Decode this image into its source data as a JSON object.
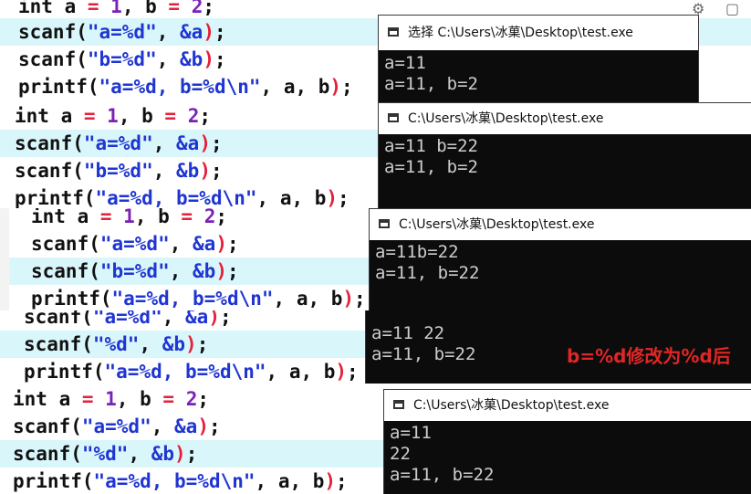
{
  "panel1": {
    "lines": [
      {
        "parts": [
          [
            "kw",
            "int a "
          ],
          [
            "op",
            "= "
          ],
          [
            "num",
            "1"
          ],
          [
            "kw",
            ", b "
          ],
          [
            "op",
            "= "
          ],
          [
            "num",
            "2"
          ],
          [
            "kw",
            ";"
          ]
        ]
      },
      {
        "parts": [
          [
            "fn",
            "scanf("
          ],
          [
            "str",
            "\"a=%d\""
          ],
          [
            "kw",
            ", "
          ],
          [
            "amp",
            "&a"
          ],
          [
            "op",
            ")"
          ],
          [
            "kw",
            ";"
          ]
        ]
      },
      {
        "parts": [
          [
            "fn",
            "scanf("
          ],
          [
            "str",
            "\"b=%d\""
          ],
          [
            "kw",
            ", "
          ],
          [
            "amp",
            "&b"
          ],
          [
            "op",
            ")"
          ],
          [
            "kw",
            ";"
          ]
        ]
      },
      {
        "parts": [
          [
            "fn",
            "printf("
          ],
          [
            "str",
            "\"a=%d, b=%d\\n\""
          ],
          [
            "kw",
            ", a, b"
          ],
          [
            "op",
            ")"
          ],
          [
            "kw",
            ";"
          ]
        ]
      }
    ],
    "console_title": "选择 C:\\Users\\冰菓\\Desktop\\test.exe",
    "output": [
      "a=11",
      "a=11, b=2"
    ]
  },
  "panel2": {
    "lines": [
      {
        "parts": [
          [
            "kw",
            "int a "
          ],
          [
            "op",
            "= "
          ],
          [
            "num",
            "1"
          ],
          [
            "kw",
            ", b "
          ],
          [
            "op",
            "= "
          ],
          [
            "num",
            "2"
          ],
          [
            "kw",
            ";"
          ]
        ]
      },
      {
        "parts": [
          [
            "fn",
            "scanf("
          ],
          [
            "str",
            "\"a=%d\""
          ],
          [
            "kw",
            ", "
          ],
          [
            "amp",
            "&a"
          ],
          [
            "op",
            ")"
          ],
          [
            "kw",
            ";"
          ]
        ]
      },
      {
        "parts": [
          [
            "fn",
            "scanf("
          ],
          [
            "str",
            "\"b=%d\""
          ],
          [
            "kw",
            ", "
          ],
          [
            "amp",
            "&b"
          ],
          [
            "op",
            ")"
          ],
          [
            "kw",
            ";"
          ]
        ]
      },
      {
        "parts": [
          [
            "fn",
            "printf("
          ],
          [
            "str",
            "\"a=%d, b=%d\\n\""
          ],
          [
            "kw",
            ", a, b"
          ],
          [
            "op",
            ")"
          ],
          [
            "kw",
            ";"
          ]
        ]
      }
    ],
    "console_title": "C:\\Users\\冰菓\\Desktop\\test.exe",
    "output": [
      "a=11 b=22",
      "a=11, b=2"
    ]
  },
  "panel3": {
    "lines": [
      {
        "parts": [
          [
            "kw",
            "int a "
          ],
          [
            "op",
            "= "
          ],
          [
            "num",
            "1"
          ],
          [
            "kw",
            ", b "
          ],
          [
            "op",
            "= "
          ],
          [
            "num",
            "2"
          ],
          [
            "kw",
            ";"
          ]
        ]
      },
      {
        "parts": [
          [
            "fn",
            "scanf("
          ],
          [
            "str",
            "\"a=%d\""
          ],
          [
            "kw",
            ", "
          ],
          [
            "amp",
            "&a"
          ],
          [
            "op",
            ")"
          ],
          [
            "kw",
            ";"
          ]
        ]
      },
      {
        "parts": [
          [
            "fn",
            "scanf("
          ],
          [
            "str",
            "\"b=%d\""
          ],
          [
            "kw",
            ", "
          ],
          [
            "amp",
            "&b"
          ],
          [
            "op",
            ")"
          ],
          [
            "kw",
            ";"
          ]
        ]
      },
      {
        "parts": [
          [
            "fn",
            "printf("
          ],
          [
            "str",
            "\"a=%d, b=%d\\n\""
          ],
          [
            "kw",
            ", a, b"
          ],
          [
            "op",
            ")"
          ],
          [
            "kw",
            ";"
          ]
        ]
      }
    ],
    "console_title": "C:\\Users\\冰菓\\Desktop\\test.exe",
    "output": [
      "a=11b=22",
      "a=11, b=22"
    ]
  },
  "panel4": {
    "lines": [
      {
        "parts": [
          [
            "fn",
            "scanf("
          ],
          [
            "str",
            "\"a=%d\""
          ],
          [
            "kw",
            ", "
          ],
          [
            "amp",
            "&a"
          ],
          [
            "op",
            ")"
          ],
          [
            "kw",
            ";"
          ]
        ]
      },
      {
        "parts": [
          [
            "fn",
            "scanf("
          ],
          [
            "str",
            "\"%d\""
          ],
          [
            "kw",
            ", "
          ],
          [
            "amp",
            "&b"
          ],
          [
            "op",
            ")"
          ],
          [
            "kw",
            ";"
          ]
        ]
      },
      {
        "parts": [
          [
            "fn",
            "printf("
          ],
          [
            "str",
            "\"a=%d, b=%d\\n\""
          ],
          [
            "kw",
            ", a, b"
          ],
          [
            "op",
            ")"
          ],
          [
            "kw",
            ";"
          ]
        ]
      }
    ],
    "output": [
      "a=11 22",
      "a=11, b=22"
    ],
    "note": "b=%d修改为%d后"
  },
  "panel5": {
    "lines": [
      {
        "parts": [
          [
            "kw",
            "int a "
          ],
          [
            "op",
            "= "
          ],
          [
            "num",
            "1"
          ],
          [
            "kw",
            ", b "
          ],
          [
            "op",
            "= "
          ],
          [
            "num",
            "2"
          ],
          [
            "kw",
            ";"
          ]
        ]
      },
      {
        "parts": [
          [
            "fn",
            "scanf("
          ],
          [
            "str",
            "\"a=%d\""
          ],
          [
            "kw",
            ", "
          ],
          [
            "amp",
            "&a"
          ],
          [
            "op",
            ")"
          ],
          [
            "kw",
            ";"
          ]
        ]
      },
      {
        "parts": [
          [
            "fn",
            "scanf("
          ],
          [
            "str",
            "\"%d\""
          ],
          [
            "kw",
            ", "
          ],
          [
            "amp",
            "&b"
          ],
          [
            "op",
            ")"
          ],
          [
            "kw",
            ";"
          ]
        ]
      },
      {
        "parts": [
          [
            "fn",
            "printf("
          ],
          [
            "str",
            "\"a=%d, b=%d\\n\""
          ],
          [
            "kw",
            ", a, b"
          ],
          [
            "op",
            ")"
          ],
          [
            "kw",
            ";"
          ]
        ]
      }
    ],
    "console_title": "C:\\Users\\冰菓\\Desktop\\test.exe",
    "output": [
      "a=11",
      "22",
      "a=11, b=22"
    ]
  }
}
